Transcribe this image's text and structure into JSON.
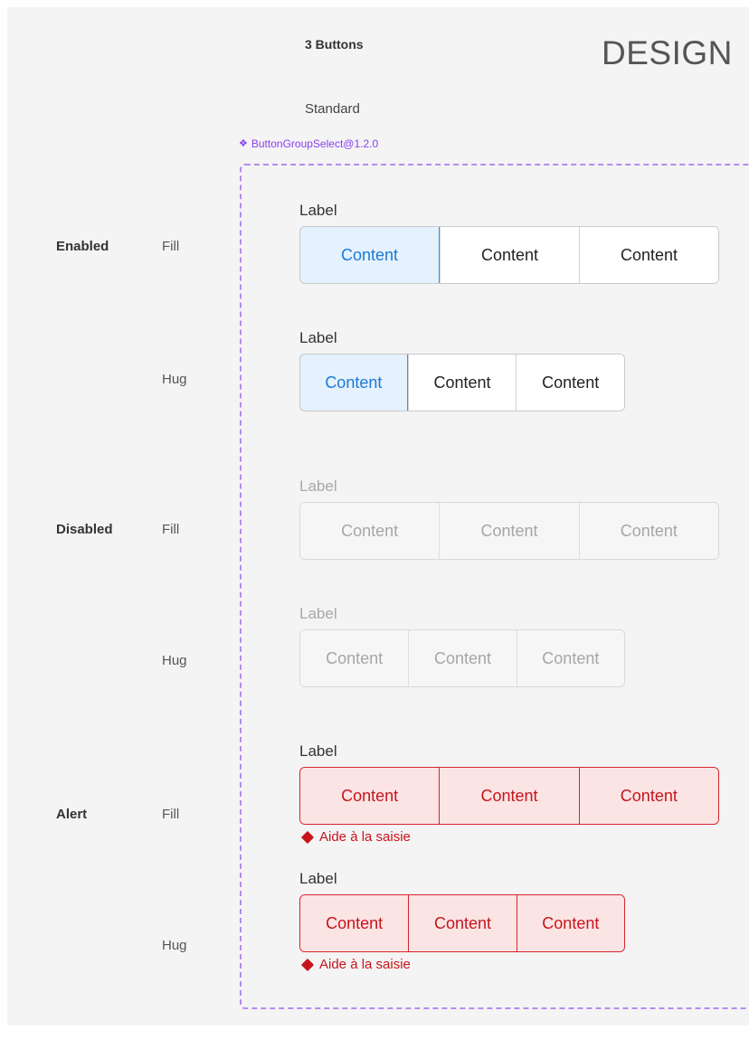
{
  "header": {
    "title": "3 Buttons",
    "design_word": "DESIGN",
    "subtitle": "Standard",
    "component_tag": "ButtonGroupSelect@1.2.0"
  },
  "rows": {
    "enabled": "Enabled",
    "disabled": "Disabled",
    "alert": "Alert"
  },
  "variants": {
    "fill": "Fill",
    "hug": "Hug"
  },
  "field_label": "Label",
  "segment_text": "Content",
  "helper_text": "Aide à la saisie",
  "colors": {
    "selected_bg": "#e5f1fd",
    "selected_text": "#1a7ad6",
    "alert_bg": "#fbe4e4",
    "alert_text": "#c7141c",
    "frame_dash": "#b48cf0"
  },
  "icons": {
    "component": "component-diamond-icon",
    "warning": "warning-diamond-icon"
  },
  "selection": {
    "enabled_selected_index": 0
  }
}
